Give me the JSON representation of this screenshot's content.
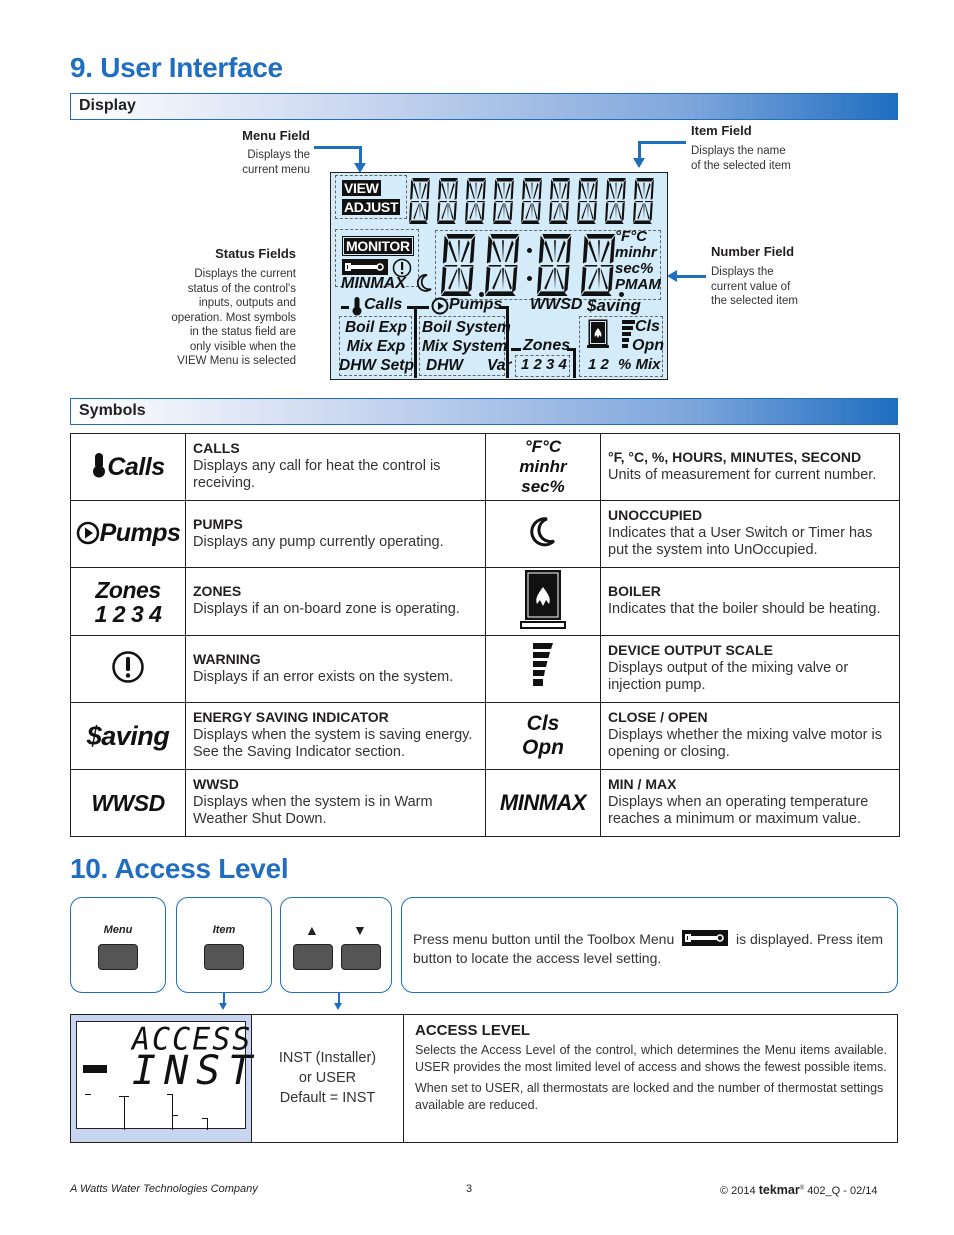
{
  "section9": {
    "title": "9. User Interface",
    "display_bar": "Display",
    "callouts": {
      "menu_field": {
        "title": "Menu Field",
        "text": [
          "Displays the",
          "current menu"
        ]
      },
      "item_field": {
        "title": "Item Field",
        "text": [
          "Displays the name",
          "of the selected item"
        ]
      },
      "status_fields": {
        "title": "Status Fields",
        "text": [
          "Displays the current",
          "status of the control's",
          "inputs, outputs and",
          "operation. Most symbols",
          "in the status field are",
          "only visible when the",
          "VIEW Menu is selected"
        ]
      },
      "number_field": {
        "title": "Number Field",
        "text": [
          "Displays the",
          "current value of",
          "the selected item"
        ]
      }
    },
    "lcd": {
      "view": "VIEW",
      "adjust": "ADJUST",
      "monitor": "MONITOR",
      "minmax": "MINMAX",
      "units": [
        "°F°C",
        "minhr",
        "sec%",
        "PMAM"
      ],
      "calls": "Calls",
      "pumps": "Pumps",
      "wwsd": "WWSD",
      "saving": "$aving",
      "calls_items": [
        "Boil Exp",
        "Mix Exp",
        "DHW Setp"
      ],
      "pumps_items": [
        "Boil System",
        "Mix System",
        "DHW",
        "Var"
      ],
      "zones": "Zones",
      "zone_numbers": "1 2 3 4",
      "boiler_numbers": "1 2",
      "cls": "Cls",
      "opn": "Opn",
      "pct_mix": "% Mix"
    },
    "symbols_bar": "Symbols",
    "symbols": [
      {
        "icon": "calls-icon",
        "icon_text": "Calls",
        "title": "CALLS",
        "text": "Displays any call for heat the control is receiving."
      },
      {
        "icon": "units-icon",
        "icon_lines": [
          "°F°C",
          "minhr",
          "sec%"
        ],
        "title": "°F, °C, %, HOURS, MINUTES, SECOND",
        "text": "Units of measurement for current number."
      },
      {
        "icon": "pumps-icon",
        "icon_text": "Pumps",
        "title": "PUMPS",
        "text": "Displays any pump currently operating."
      },
      {
        "icon": "moon-icon",
        "title": "UNOCCUPIED",
        "text": "Indicates that a User Switch or Timer has put the system into UnOccupied."
      },
      {
        "icon": "zones-icon",
        "icon_lines": [
          "Zones",
          "1 2 3 4"
        ],
        "title": "ZONES",
        "text": "Displays if an on-board zone is operating."
      },
      {
        "icon": "boiler-icon",
        "title": "BOILER",
        "text": "Indicates that the boiler should be heating."
      },
      {
        "icon": "warning-icon",
        "title": "WARNING",
        "text": "Displays if an error exists on the system."
      },
      {
        "icon": "output-scale-icon",
        "title": "DEVICE OUTPUT SCALE",
        "text": "Displays output of the mixing valve or injection pump."
      },
      {
        "icon": "saving-icon",
        "icon_text": "$aving",
        "title": "ENERGY SAVING INDICATOR",
        "text": "Displays when the system is saving energy. See the Saving Indicator section."
      },
      {
        "icon": "cls-opn-icon",
        "icon_lines": [
          "Cls",
          "Opn"
        ],
        "title": "CLOSE / OPEN",
        "text": "Displays whether the mixing valve motor is opening or closing."
      },
      {
        "icon": "wwsd-icon",
        "icon_text": "WWSD",
        "title": "WWSD",
        "text": "Displays when the system is in Warm Weather Shut Down."
      },
      {
        "icon": "minmax-icon",
        "icon_text": "MINMAX",
        "title": "MIN / MAX",
        "text": "Displays when an operating temperature reaches a minimum or maximum value."
      }
    ]
  },
  "section10": {
    "title": "10. Access Level",
    "buttons": {
      "menu": "Menu",
      "item": "Item",
      "up": "▲",
      "down": "▼"
    },
    "instruction_pre": "Press menu button until the Toolbox Menu",
    "instruction_post": "is displayed. Press item button to locate the access level setting.",
    "lcd_line1": "ACCESS",
    "lcd_line2": "INST",
    "options": [
      "INST (Installer)",
      "or USER",
      "Default = INST"
    ],
    "setting_title": "ACCESS LEVEL",
    "setting_text1": "Selects the Access Level of the control, which determines the Menu items available. USER provides the most limited level of access and shows the fewest possible items.",
    "setting_text2": "When set to USER, all thermostats are locked and the number of thermostat settings available are reduced."
  },
  "footer": {
    "company": "A Watts Water Technologies Company",
    "page": "3",
    "copyright": "© 2014",
    "brand": "tekmar",
    "doc": "402_Q - 02/14"
  }
}
